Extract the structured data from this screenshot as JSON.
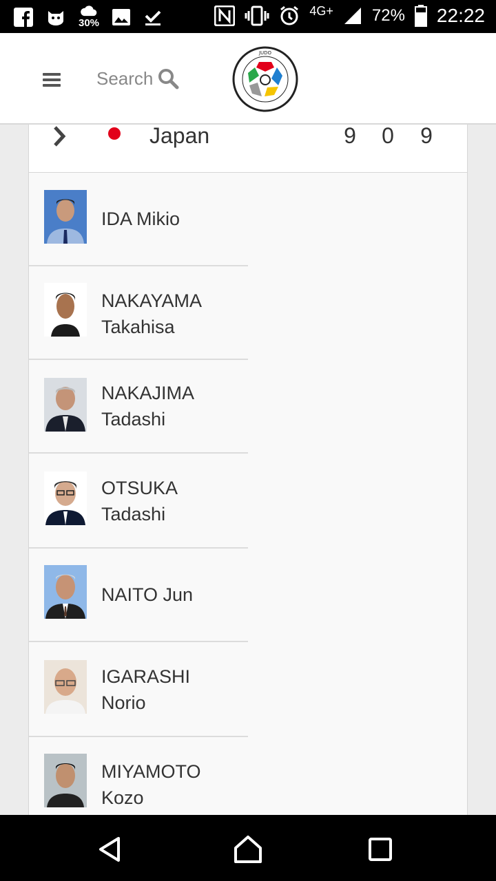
{
  "status_bar": {
    "badge_percent": "30%",
    "network": "4G+",
    "battery": "72%",
    "time": "22:22"
  },
  "header": {
    "search_label": "Search",
    "logo_name": "international-judo-federation-logo"
  },
  "country": {
    "name": "Japan",
    "flag_color": "#e2001a",
    "stats": [
      "9",
      "0",
      "9"
    ]
  },
  "people": [
    {
      "line1": "IDA Mikio",
      "line2": ""
    },
    {
      "line1": "NAKAYAMA",
      "line2": "Takahisa"
    },
    {
      "line1": "NAKAJIMA",
      "line2": "Tadashi"
    },
    {
      "line1": "OTSUKA",
      "line2": "Tadashi"
    },
    {
      "line1": "NAITO Jun",
      "line2": ""
    },
    {
      "line1": "IGARASHI",
      "line2": "Norio"
    },
    {
      "line1": "MIYAMOTO",
      "line2": "Kozo"
    }
  ]
}
